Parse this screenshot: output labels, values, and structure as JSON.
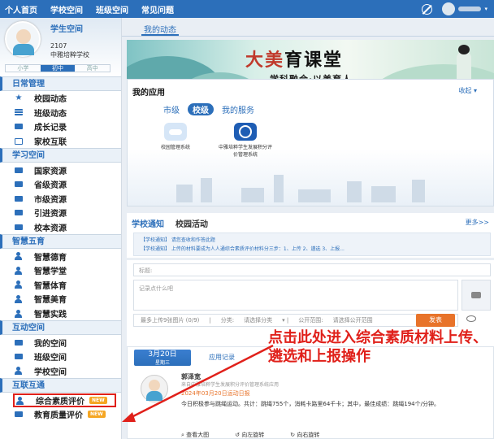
{
  "topnav": {
    "items": [
      "个人首页",
      "学校空间",
      "班级空间",
      "常见问题"
    ]
  },
  "profile": {
    "title": "学生空间",
    "student_id": "2107",
    "school": "中雅培粹学校",
    "grades": [
      "小学",
      "初中",
      "高中"
    ],
    "active_grade": 1
  },
  "sidebar": {
    "sections": [
      {
        "title": "日常管理",
        "items": [
          {
            "label": "校园动态",
            "icon": "star-icon"
          },
          {
            "label": "班级动态",
            "icon": "list-icon"
          },
          {
            "label": "成长记录",
            "icon": "screen-icon"
          },
          {
            "label": "家校互联",
            "icon": "box-icon"
          }
        ]
      },
      {
        "title": "学习空间",
        "items": [
          {
            "label": "国家资源",
            "icon": "screen-icon"
          },
          {
            "label": "省级资源",
            "icon": "screen-icon"
          },
          {
            "label": "市级资源",
            "icon": "screen-icon"
          },
          {
            "label": "引进资源",
            "icon": "screen-icon"
          },
          {
            "label": "校本资源",
            "icon": "screen-icon"
          }
        ]
      },
      {
        "title": "智慧五育",
        "items": [
          {
            "label": "智慧德育",
            "icon": "user-icon"
          },
          {
            "label": "智慧学堂",
            "icon": "user-icon"
          },
          {
            "label": "智慧体育",
            "icon": "user-icon"
          },
          {
            "label": "智慧美育",
            "icon": "user-icon"
          },
          {
            "label": "智慧实践",
            "icon": "user-icon"
          }
        ]
      },
      {
        "title": "互动空间",
        "items": [
          {
            "label": "我的空间",
            "icon": "screen-icon"
          },
          {
            "label": "班级空间",
            "icon": "screen-icon"
          },
          {
            "label": "学校空间",
            "icon": "user-icon"
          }
        ]
      },
      {
        "title": "互联互通",
        "items": [
          {
            "label": "综合素质评价",
            "icon": "user-icon",
            "badge": "NEW",
            "highlight": true
          },
          {
            "label": "教育质量评价",
            "icon": "screen-icon",
            "badge": "NEW"
          }
        ]
      }
    ]
  },
  "main": {
    "dynamic_tab": "我的动态",
    "banner": {
      "title_a": "大",
      "title_b": "美",
      "title_c": "育课堂",
      "subtitle": "学科融合·以美育人",
      "dots": "● ●"
    },
    "apps": {
      "title": "我的应用",
      "collapse": "收起 ▾",
      "tabs": [
        "市级",
        "校级",
        "我的服务"
      ],
      "active_tab": 1,
      "items": [
        {
          "label": "校园管理系统"
        },
        {
          "label": "中雅培粹学生发展积分评价管理系统"
        }
      ]
    },
    "notice": {
      "tabs": [
        "学校通知",
        "校园活动"
      ],
      "more": "更多>>",
      "lines": [
        "【学校通知】 请您查收和作答此题",
        "【学校通知】 上传的材料要成为人人通综合素质评价材料分三步：1、上传 2、遴选 3、上报..."
      ]
    },
    "post": {
      "title_placeholder": "标题:",
      "body_placeholder": "记录点什么吧",
      "upload_hint": "最多上传9张图片 (0/9)",
      "category_label": "分类:",
      "category_value": "请选择分类",
      "scope_label": "公开范围:",
      "scope_value": "请选择公开范围",
      "publish": "发表"
    },
    "feed": {
      "date": "3月20日",
      "weekday": "星期三",
      "type": "应用记录",
      "name": "郭泽宽",
      "tag": "",
      "source": "来自中雅培粹学生发展积分评价管理系统应用",
      "datetime": "2024年03月20日运动日报",
      "text": "今日积极参与跳绳运动。共计：跳绳755个，消耗卡路里64千卡；其中，最佳成绩：跳绳194个/分钟。",
      "actions": [
        "查看大图",
        "向左旋转",
        "向右旋转"
      ]
    }
  },
  "annotation": "点击此处进入综合素质材料上传、遴选和上报操作"
}
